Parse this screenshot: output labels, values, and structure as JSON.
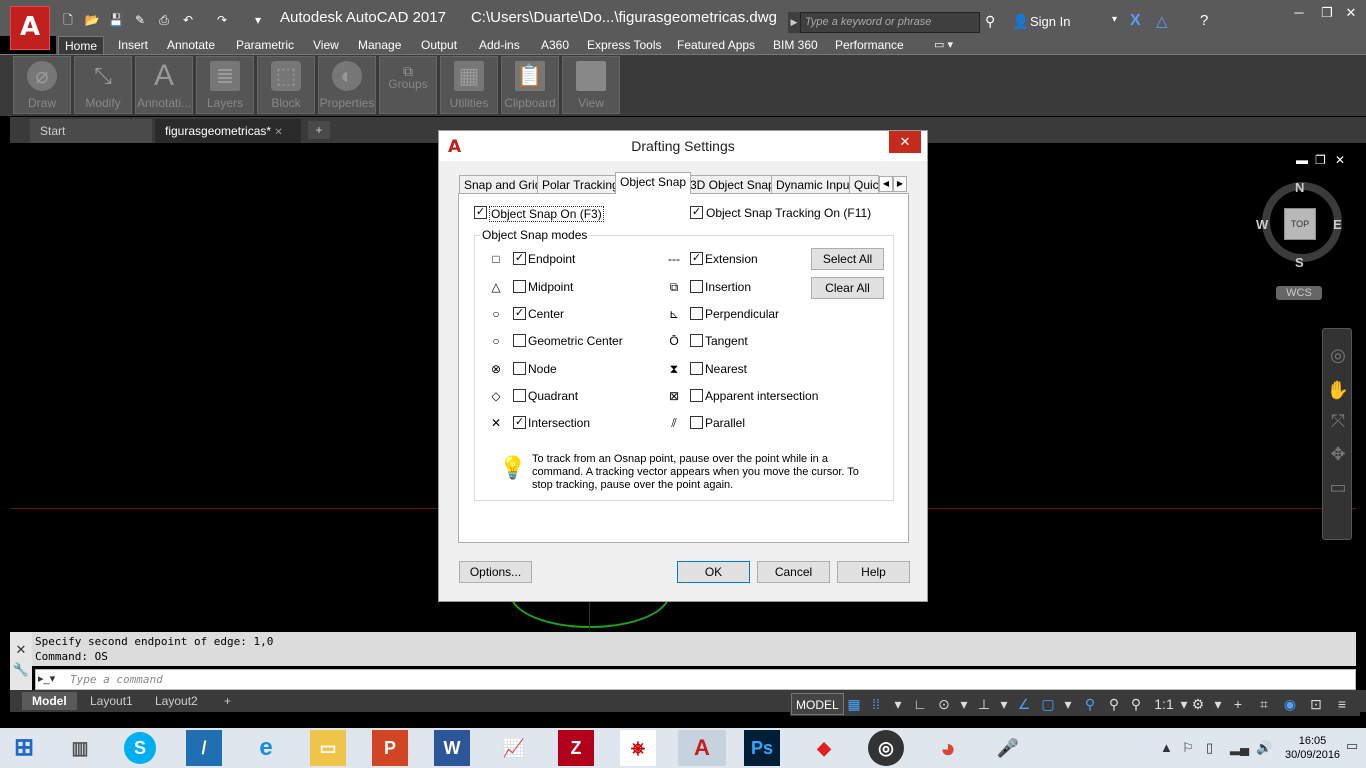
{
  "window": {
    "title": "Autodesk AutoCAD 2017",
    "file_path": "C:\\Users\\Duarte\\Do...\\figurasgeometricas.dwg",
    "search_placeholder": "Type a keyword or phrase",
    "sign_in": "Sign In"
  },
  "ribbon": {
    "tabs": [
      "Home",
      "Insert",
      "Annotate",
      "Parametric",
      "View",
      "Manage",
      "Output",
      "Add-ins",
      "A360",
      "Express Tools",
      "Featured Apps",
      "BIM 360",
      "Performance"
    ],
    "active_tab": "Home",
    "panels": [
      "Draw",
      "Modify",
      "Annotati...",
      "Layers",
      "Block",
      "Properties",
      "Groups",
      "Utilities",
      "Clipboard",
      "View"
    ]
  },
  "doc_tabs": {
    "start": "Start",
    "active": "figurasgeometricas*",
    "add": "+"
  },
  "viewcube": {
    "north": "N",
    "south": "S",
    "east": "E",
    "west": "W",
    "face": "TOP",
    "wcs": "WCS"
  },
  "command": {
    "history": [
      "Specify second endpoint of edge: 1,0",
      "Command: OS"
    ],
    "placeholder": "Type a command"
  },
  "layout_tabs": [
    "Model",
    "Layout1",
    "Layout2"
  ],
  "status": {
    "model": "MODEL",
    "scale": "1:1"
  },
  "taskbar": {
    "time": "16:05",
    "date": "30/09/2016"
  },
  "dialog": {
    "title": "Drafting Settings",
    "tabs": [
      "Snap and Grid",
      "Polar Tracking",
      "Object Snap",
      "3D Object Snap",
      "Dynamic Input",
      "Quic"
    ],
    "active_tab": "Object Snap",
    "osnap_on": {
      "label": "Object Snap On (F3)",
      "checked": true
    },
    "tracking_on": {
      "label": "Object Snap Tracking On (F11)",
      "checked": true
    },
    "modes_label": "Object Snap modes",
    "left_modes": [
      {
        "label": "Endpoint",
        "checked": true,
        "icon": "□"
      },
      {
        "label": "Midpoint",
        "checked": false,
        "icon": "△"
      },
      {
        "label": "Center",
        "checked": true,
        "icon": "○"
      },
      {
        "label": "Geometric Center",
        "checked": false,
        "icon": "○"
      },
      {
        "label": "Node",
        "checked": false,
        "icon": "⊗"
      },
      {
        "label": "Quadrant",
        "checked": false,
        "icon": "◇"
      },
      {
        "label": "Intersection",
        "checked": true,
        "icon": "✕"
      }
    ],
    "right_modes": [
      {
        "label": "Extension",
        "checked": true,
        "icon": "---"
      },
      {
        "label": "Insertion",
        "checked": false,
        "icon": "⧉"
      },
      {
        "label": "Perpendicular",
        "checked": false,
        "icon": "⊾"
      },
      {
        "label": "Tangent",
        "checked": false,
        "icon": "Ō"
      },
      {
        "label": "Nearest",
        "checked": false,
        "icon": "⧗"
      },
      {
        "label": "Apparent intersection",
        "checked": false,
        "icon": "⊠"
      },
      {
        "label": "Parallel",
        "checked": false,
        "icon": "⫽"
      }
    ],
    "select_all": "Select All",
    "clear_all": "Clear All",
    "hint": "To track from an Osnap point, pause over the point while in a command.  A tracking vector appears when you move the cursor. To stop tracking, pause over the point again.",
    "options": "Options...",
    "ok": "OK",
    "cancel": "Cancel",
    "help": "Help"
  }
}
